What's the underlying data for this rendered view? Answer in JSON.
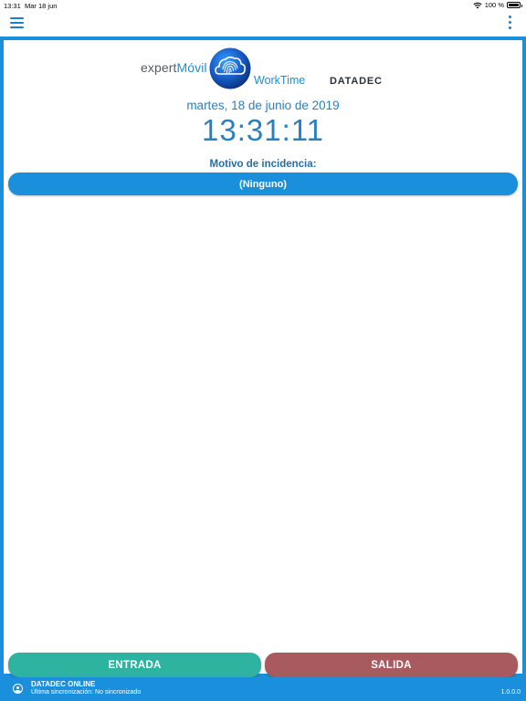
{
  "status_bar": {
    "time": "13:31",
    "date": "Mar 18 jun",
    "battery": "100 %"
  },
  "header": {
    "brand_prefix": "expert",
    "brand_accent": "Móvil",
    "product": "WorkTime",
    "company": "DATADEC"
  },
  "main": {
    "date": "martes, 18 de junio de 2019",
    "clock": "13:31:11",
    "motivo_label": "Motivo de incidencia:",
    "motivo_value": "(Ninguno)"
  },
  "actions": {
    "entrada_label": "ENTRADA",
    "salida_label": "SALIDA"
  },
  "footer": {
    "server": "DATADEC ONLINE",
    "sync_status": "Última sincronización: No sincronizado",
    "version": "1.0.0.0"
  },
  "colors": {
    "primary": "#1a8fdc",
    "entrada": "#2db3a0",
    "salida": "#a85a5e",
    "text_blue": "#2a7fc0"
  }
}
